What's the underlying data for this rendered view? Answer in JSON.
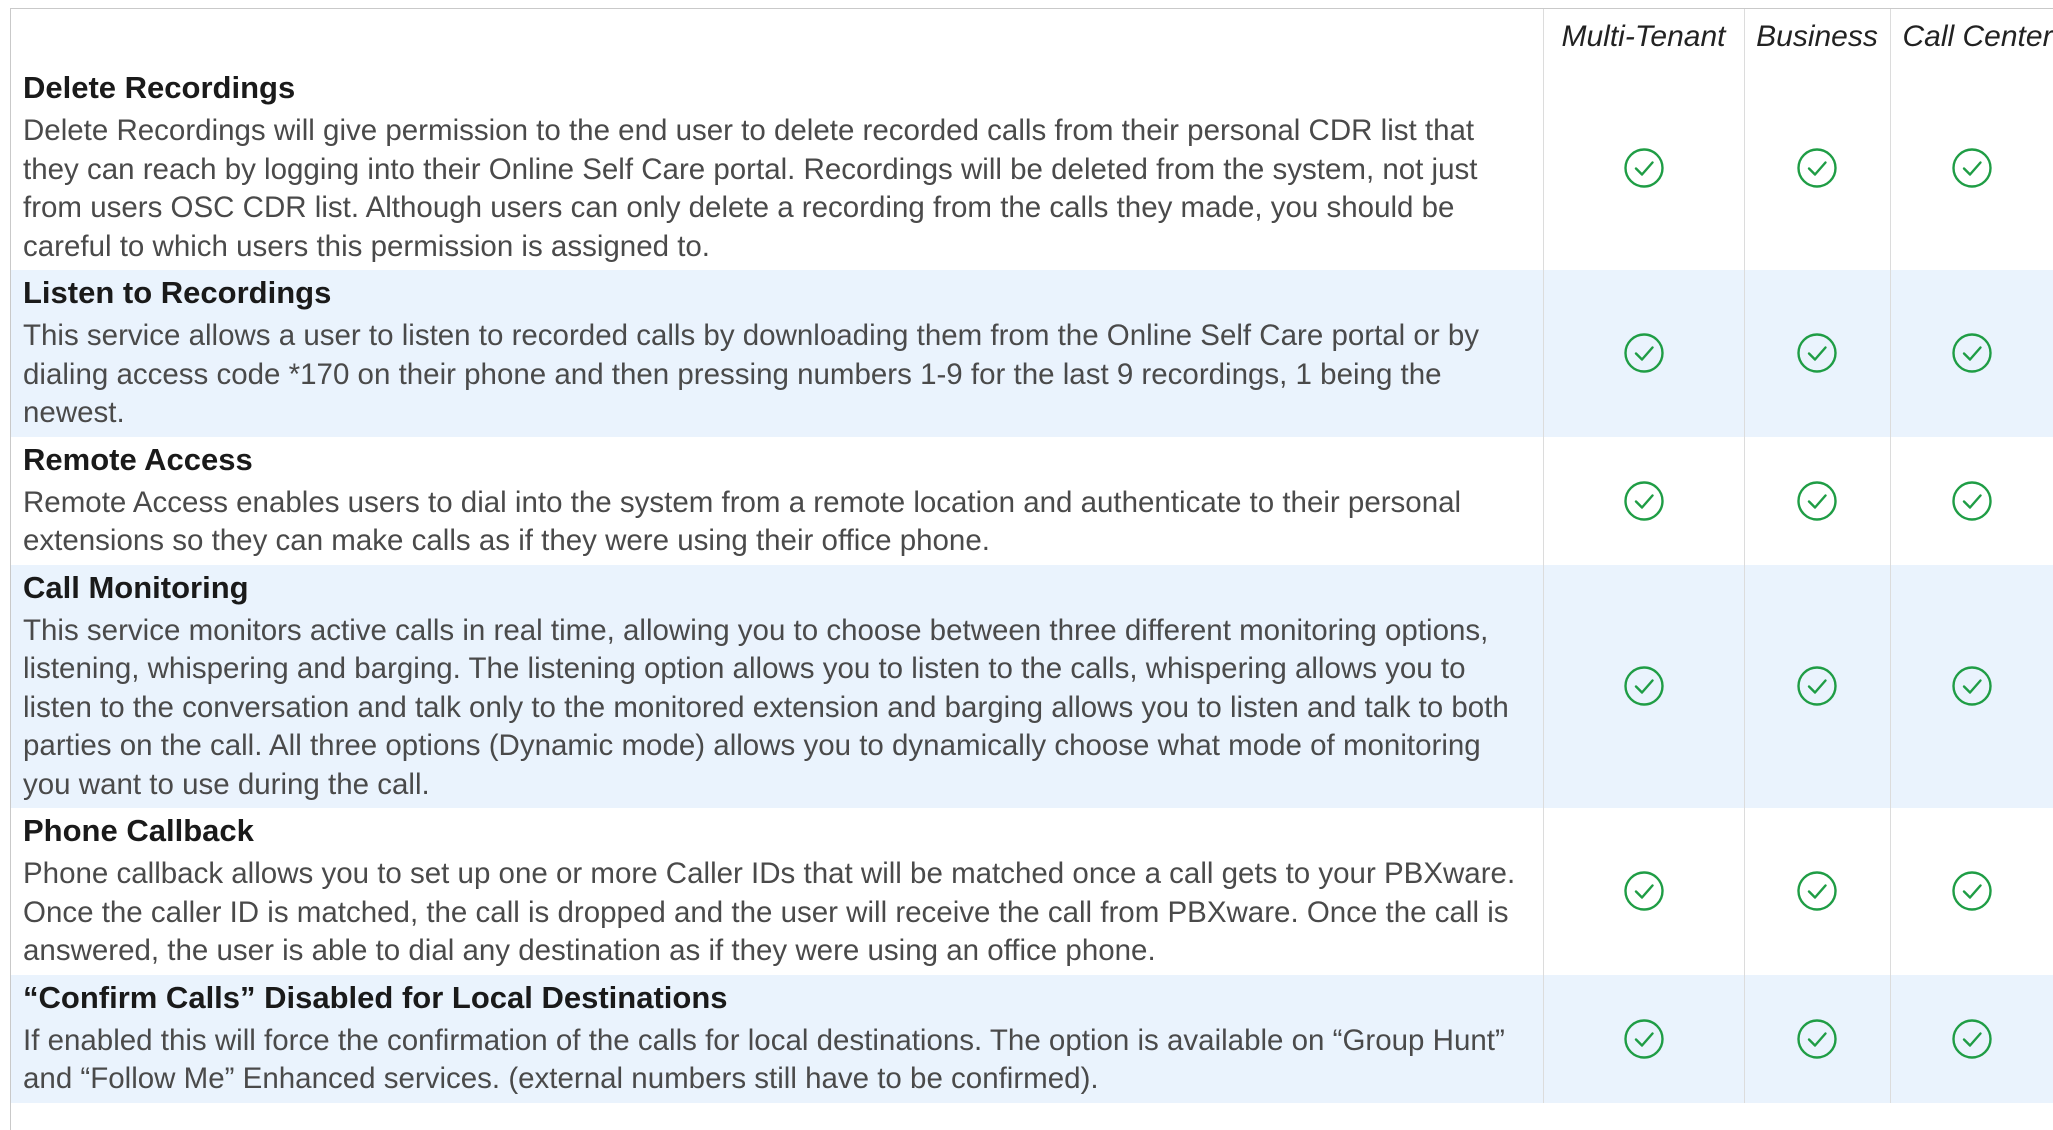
{
  "columns": {
    "multi_tenant": "Multi-Tenant",
    "business": "Business",
    "call_center": "Call Center"
  },
  "check_color": "#1f9d45",
  "alt_row_color": "#eaf3fd",
  "features": [
    {
      "title": "Delete Recordings",
      "description": "Delete Recordings will give permission to the end user to delete recorded calls from their personal CDR list that they can reach by logging into their Online Self Care portal. Recordings will be deleted from the system, not just from users OSC CDR list. Although users can only delete a recording from the calls they made, you should be careful to which users this permission is assigned to.",
      "multi_tenant": "check-icon",
      "business": "check-icon",
      "call_center": "check-icon"
    },
    {
      "title": "Listen to Recordings",
      "description": "This service allows a user to listen to recorded calls by downloading them from the Online Self Care portal or by dialing access code *170 on their phone and then pressing numbers 1-9 for the last 9 recordings, 1 being the newest.",
      "multi_tenant": "check-icon",
      "business": "check-icon",
      "call_center": "check-icon"
    },
    {
      "title": "Remote Access",
      "description": "Remote Access enables users to dial into the system from a remote location and authenticate to their personal extensions so they can make calls as if they were using their office phone.",
      "multi_tenant": "check-icon",
      "business": "check-icon",
      "call_center": "check-icon"
    },
    {
      "title": "Call Monitoring",
      "description": "This service monitors active calls in real time, allowing you to choose between three different monitoring options, listening, whispering and barging. The listening option allows you to listen to the calls, whispering allows you to listen to the conversation and talk only to the monitored extension and barging allows you to listen and talk to both parties on the call. All three options (Dynamic mode) allows you to dynamically choose what mode of monitoring you want to use during the call.",
      "multi_tenant": "check-icon",
      "business": "check-icon",
      "call_center": "check-icon"
    },
    {
      "title": "Phone Callback",
      "description": "Phone callback allows you to set up one or more Caller IDs that will be matched once a call gets to your PBXware. Once the caller ID is matched, the call is dropped and the user will receive the call from PBXware. Once the call is answered, the user is able to dial any destination as if they were using an office phone.",
      "multi_tenant": "check-icon",
      "business": "check-icon",
      "call_center": "check-icon"
    },
    {
      "title": "“Confirm Calls” Disabled for Local Destinations",
      "description": "If enabled this will force the confirmation of the calls for local destinations. The option is available on “Group Hunt” and “Follow Me” Enhanced services. (external numbers still have to be confirmed).",
      "multi_tenant": "check-icon",
      "business": "check-icon",
      "call_center": "check-icon"
    }
  ]
}
